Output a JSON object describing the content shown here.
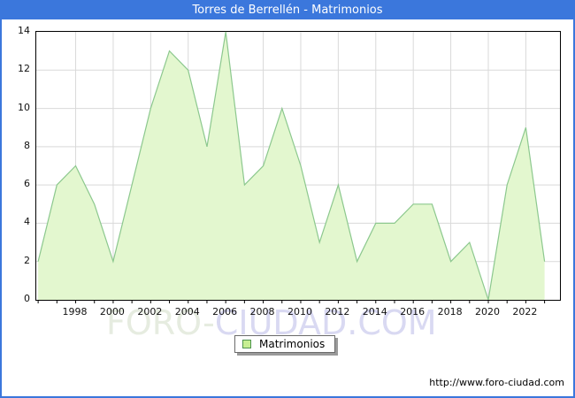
{
  "window": {
    "title": "Torres de Berrellén - Matrimonios",
    "url_footer": "http://www.foro-ciudad.com",
    "watermark_part1": "FORO-",
    "watermark_part2": "CIUDAD.COM"
  },
  "legend": {
    "label": "Matrimonios"
  },
  "colors": {
    "titlebar_bg": "#3b77dc",
    "window_border": "#3b77dc",
    "plot_border": "#000000",
    "gridline": "#d9d9d9",
    "area_fill": "#e3f7cf",
    "area_line": "#8cc88e",
    "legend_swatch_fill": "#c7ef92",
    "legend_swatch_border": "#4e944e",
    "watermark_part1_color": "#e6ece0",
    "watermark_part2_color": "#d9d9f2"
  },
  "chart_data": {
    "type": "area",
    "title": "Torres de Berrellén - Matrimonios",
    "series_name": "Matrimonios",
    "x": [
      1996,
      1997,
      1998,
      1999,
      2000,
      2001,
      2002,
      2003,
      2004,
      2005,
      2006,
      2007,
      2008,
      2009,
      2010,
      2011,
      2012,
      2013,
      2014,
      2015,
      2016,
      2017,
      2018,
      2019,
      2020,
      2021,
      2022,
      2023
    ],
    "values": [
      2,
      6,
      7,
      5,
      2,
      6,
      10,
      13,
      12,
      8,
      14,
      6,
      7,
      10,
      7,
      3,
      6,
      2,
      4,
      4,
      5,
      5,
      2,
      3,
      0,
      6,
      9,
      2
    ],
    "ylim": [
      0,
      14
    ],
    "ytick_step": 2,
    "xtick_labels": [
      1998,
      2000,
      2002,
      2004,
      2006,
      2008,
      2010,
      2012,
      2014,
      2016,
      2018,
      2020,
      2022
    ],
    "grid": true,
    "legend_position": "bottom-center"
  }
}
